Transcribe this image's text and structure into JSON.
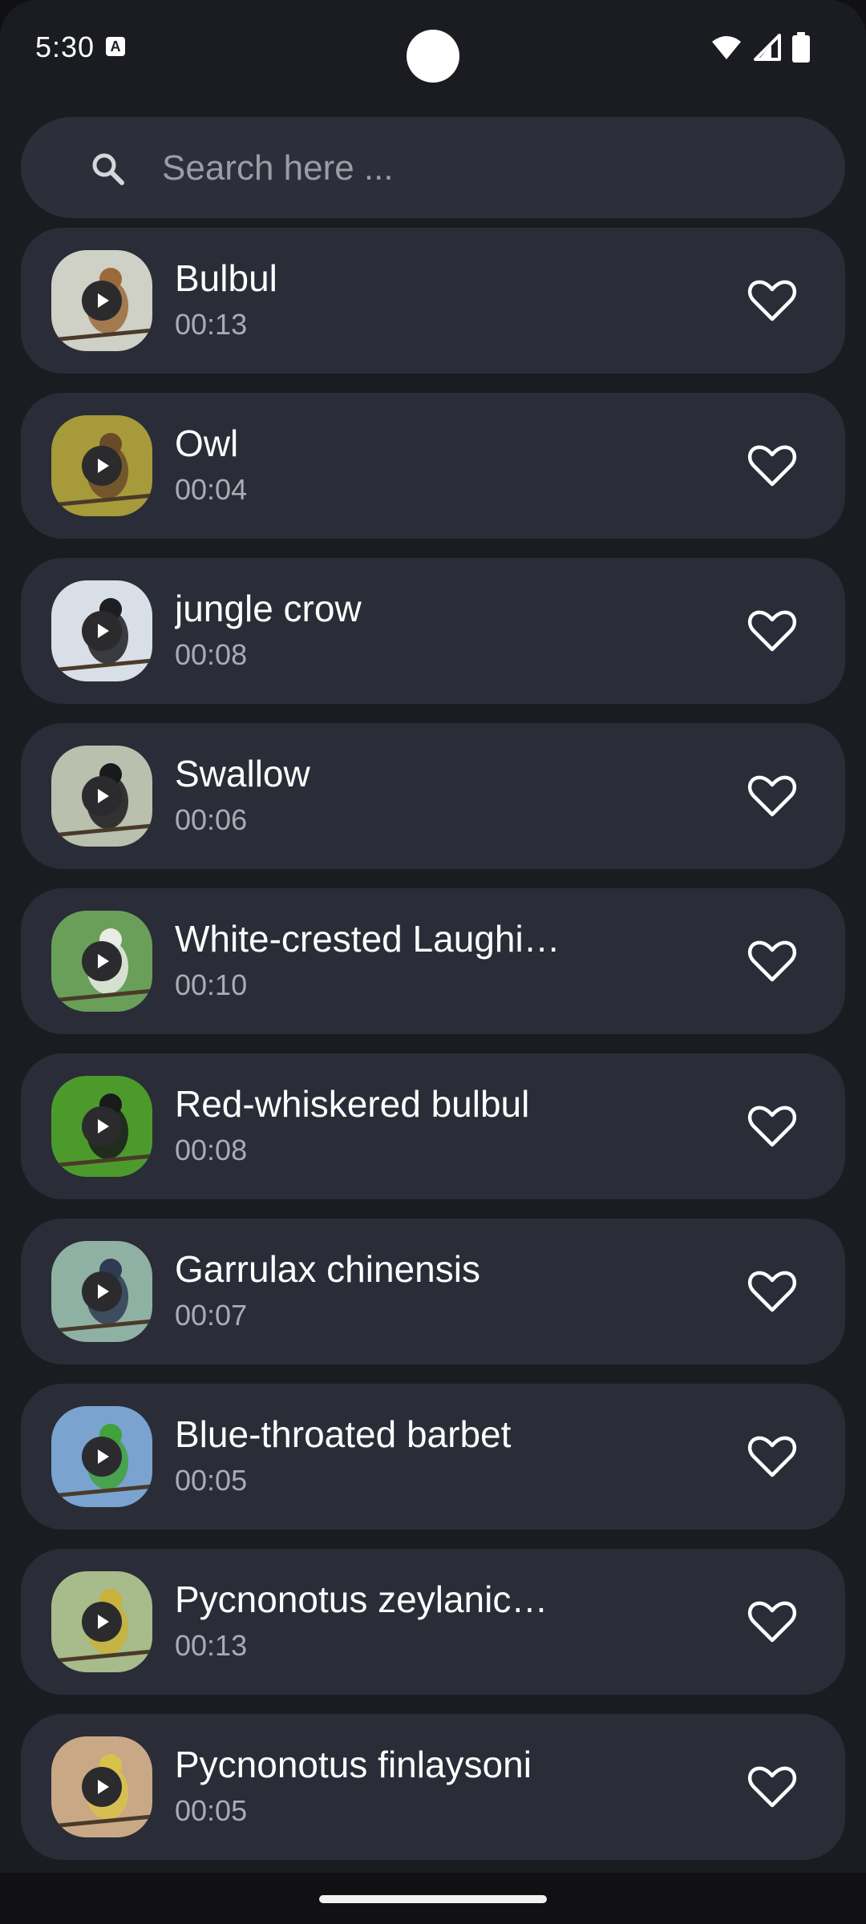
{
  "status_bar": {
    "time": "5:30",
    "notification_icon": "a-icon",
    "icons": [
      "wifi-icon",
      "signal-icon",
      "battery-icon"
    ]
  },
  "search": {
    "placeholder": "Search here ..."
  },
  "colors": {
    "background": "#1b1c21",
    "card": "#2a2c37",
    "search_bg": "#2c2f3a",
    "title": "#ffffff",
    "subtitle": "#a9abb5"
  },
  "birds": [
    {
      "name": "Bulbul",
      "duration": "00:13",
      "thumb_color": "#cfd0c6",
      "accent": "#9b6a3a"
    },
    {
      "name": "Owl",
      "duration": "00:04",
      "thumb_color": "#a69a3a",
      "accent": "#6b4a2a"
    },
    {
      "name": "jungle crow",
      "duration": "00:08",
      "thumb_color": "#d9dfe6",
      "accent": "#1d1e22"
    },
    {
      "name": "Swallow",
      "duration": "00:06",
      "thumb_color": "#b9c0ad",
      "accent": "#1a1a1a"
    },
    {
      "name": "White-crested Laughi…",
      "duration": "00:10",
      "thumb_color": "#6a9f5a",
      "accent": "#e9ebe6"
    },
    {
      "name": "Red-whiskered bulbul",
      "duration": "00:08",
      "thumb_color": "#4c9a2c",
      "accent": "#1a1a1a"
    },
    {
      "name": "Garrulax chinensis",
      "duration": "00:07",
      "thumb_color": "#8fb1a4",
      "accent": "#2f3b52"
    },
    {
      "name": "Blue-throated barbet",
      "duration": "00:05",
      "thumb_color": "#7aa3d0",
      "accent": "#3fa23a"
    },
    {
      "name": "Pycnonotus zeylanic…",
      "duration": "00:13",
      "thumb_color": "#a8bb8a",
      "accent": "#c9b23a"
    },
    {
      "name": "Pycnonotus finlaysoni",
      "duration": "00:05",
      "thumb_color": "#c9a985",
      "accent": "#d9c24a"
    }
  ]
}
